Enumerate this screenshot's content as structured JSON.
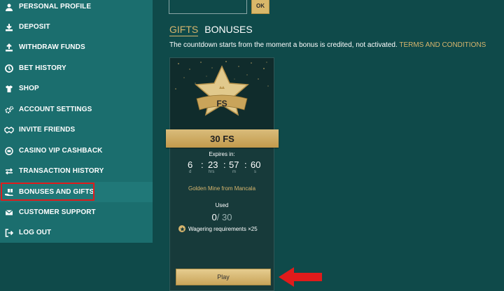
{
  "sidebar": {
    "items": [
      {
        "label": "PERSONAL PROFILE",
        "icon": "user-icon"
      },
      {
        "label": "DEPOSIT",
        "icon": "download-icon"
      },
      {
        "label": "WITHDRAW FUNDS",
        "icon": "upload-icon"
      },
      {
        "label": "BET HISTORY",
        "icon": "clock-icon"
      },
      {
        "label": "SHOP",
        "icon": "shirt-icon"
      },
      {
        "label": "ACCOUNT SETTINGS",
        "icon": "gears-icon"
      },
      {
        "label": "INVITE FRIENDS",
        "icon": "handshake-icon"
      },
      {
        "label": "CASINO VIP CASHBACK",
        "icon": "cashback-icon"
      },
      {
        "label": "TRANSACTION HISTORY",
        "icon": "arrows-icon"
      },
      {
        "label": "BONUSES AND GIFTS",
        "icon": "gift-hand-icon",
        "active": true
      },
      {
        "label": "CUSTOMER SUPPORT",
        "icon": "mail-icon"
      },
      {
        "label": "LOG OUT",
        "icon": "logout-icon"
      }
    ]
  },
  "promo": {
    "ok_label": "OK"
  },
  "tabs": {
    "gifts": "GIFTS",
    "bonuses": "BONUSES"
  },
  "note": {
    "text": "The countdown starts from the moment a bonus is credited, not activated.",
    "terms": "TERMS AND CONDITIONS"
  },
  "card": {
    "badge": "FS",
    "amount": "30 FS",
    "expires_label": "Expires in:",
    "countdown": {
      "days": "6",
      "hours": "23",
      "minutes": "57",
      "seconds": "60",
      "d_label": "d",
      "h_label": "hrs",
      "m_label": "m",
      "s_label": "s",
      "sep": ":"
    },
    "game": "Golden Mine from Mancala",
    "used_label": "Used",
    "used_current": "0",
    "used_total": "/ 30",
    "wager": "Wagering requirements ×25",
    "play_label": "Play"
  },
  "colors": {
    "accent": "#d7b56d",
    "highlight": "#e01b1b",
    "background": "#0f4a4a",
    "sidebar": "#1b6e6e"
  }
}
